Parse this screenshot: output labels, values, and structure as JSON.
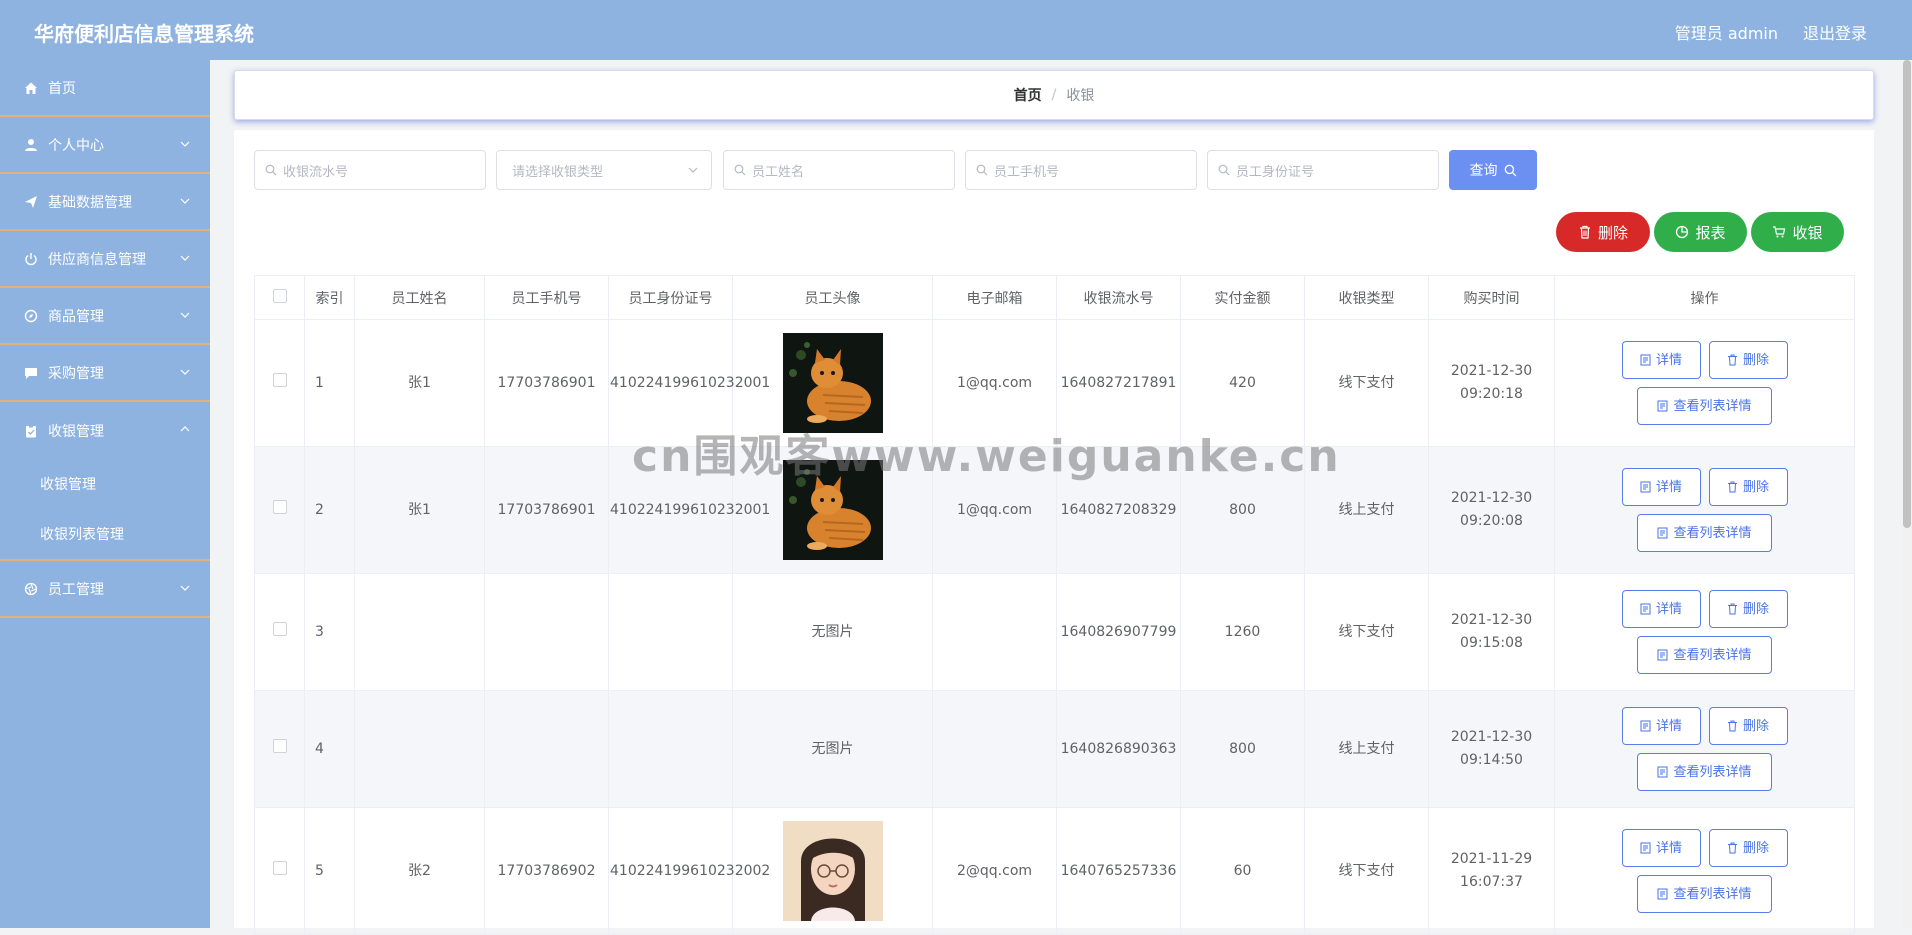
{
  "header": {
    "app_title": "华府便利店信息管理系统",
    "admin_label": "管理员 admin",
    "logout_label": "退出登录"
  },
  "sidebar": {
    "items": [
      {
        "label": "首页",
        "icon": "home-icon"
      },
      {
        "label": "个人中心",
        "icon": "user-icon"
      },
      {
        "label": "基础数据管理",
        "icon": "send-icon"
      },
      {
        "label": "供应商信息管理",
        "icon": "power-icon"
      },
      {
        "label": "商品管理",
        "icon": "compass-icon"
      },
      {
        "label": "采购管理",
        "icon": "chat-icon"
      },
      {
        "label": "收银管理",
        "icon": "clipboard-icon"
      },
      {
        "label": "员工管理",
        "icon": "aperture-icon"
      }
    ],
    "submenu": [
      "收银管理",
      "收银列表管理"
    ]
  },
  "breadcrumb": {
    "home": "首页",
    "separator": "/",
    "current": "收银"
  },
  "search": {
    "serial_placeholder": "收银流水号",
    "type_placeholder": "请选择收银类型",
    "name_placeholder": "员工姓名",
    "phone_placeholder": "员工手机号",
    "idcard_placeholder": "员工身份证号",
    "query_label": "查询"
  },
  "actions": {
    "delete_label": "删除",
    "report_label": "报表",
    "cashier_label": "收银"
  },
  "table": {
    "headers": [
      "索引",
      "员工姓名",
      "员工手机号",
      "员工身份证号",
      "员工头像",
      "电子邮箱",
      "收银流水号",
      "实付金额",
      "收银类型",
      "购买时间",
      "操作"
    ],
    "rows": [
      {
        "index": "1",
        "name": "张1",
        "phone": "17703786901",
        "idcard": "410224199610232001",
        "avatar": "cat",
        "email": "1@qq.com",
        "serial": "1640827217891",
        "amount": "420",
        "type": "线下支付",
        "time": "2021-12-30 09:20:18"
      },
      {
        "index": "2",
        "name": "张1",
        "phone": "17703786901",
        "idcard": "410224199610232001",
        "avatar": "cat",
        "email": "1@qq.com",
        "serial": "1640827208329",
        "amount": "800",
        "type": "线上支付",
        "time": "2021-12-30 09:20:08"
      },
      {
        "index": "3",
        "name": "",
        "phone": "",
        "idcard": "",
        "avatar": "无图片",
        "email": "",
        "serial": "1640826907799",
        "amount": "1260",
        "type": "线下支付",
        "time": "2021-12-30 09:15:08"
      },
      {
        "index": "4",
        "name": "",
        "phone": "",
        "idcard": "",
        "avatar": "无图片",
        "email": "",
        "serial": "1640826890363",
        "amount": "800",
        "type": "线上支付",
        "time": "2021-12-30 09:14:50"
      },
      {
        "index": "5",
        "name": "张2",
        "phone": "17703786902",
        "idcard": "410224199610232002",
        "avatar": "girl",
        "email": "2@qq.com",
        "serial": "1640765257336",
        "amount": "60",
        "type": "线下支付",
        "time": "2021-11-29 16:07:37"
      }
    ],
    "op_detail": "详情",
    "op_delete": "删除",
    "op_list_detail": "查看列表详情"
  },
  "watermark": "cn围观客www.weiguanke.cn",
  "colors": {
    "header_bg": "#8fb3e0",
    "accent": "#6c8ff2",
    "delete_red": "#d82929",
    "green": "#2fae4a",
    "divider_orange": "#e3b27b"
  }
}
